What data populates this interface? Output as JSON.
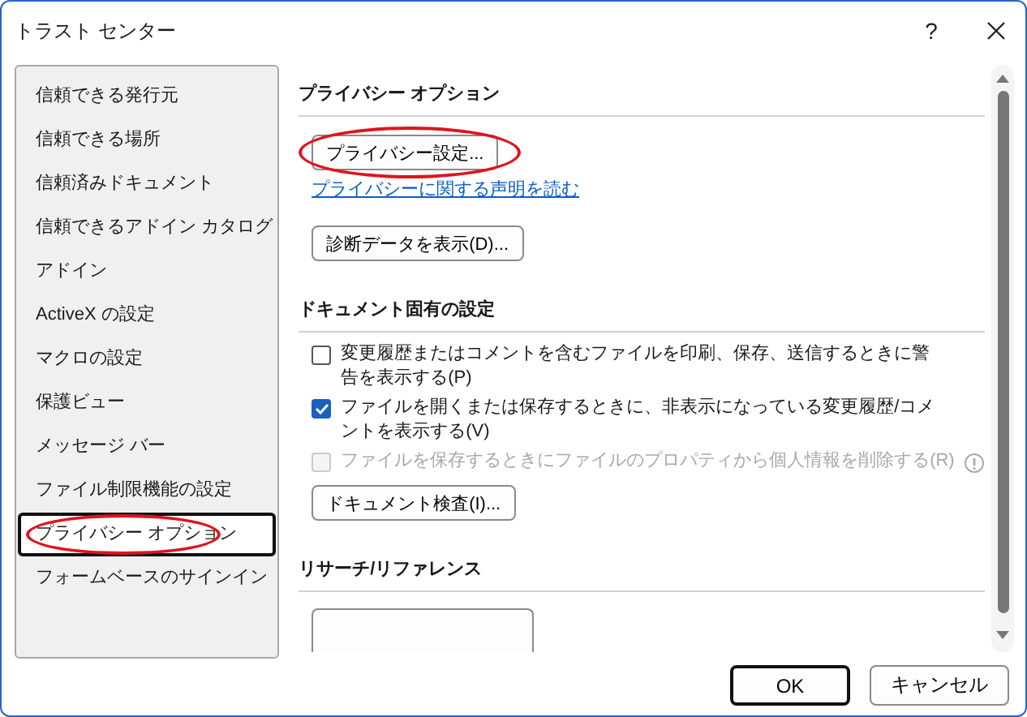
{
  "window": {
    "title": "トラスト センター",
    "help": "?"
  },
  "sidebar": {
    "items": [
      {
        "label": "信頼できる発行元",
        "selected": false,
        "circled": false
      },
      {
        "label": "信頼できる場所",
        "selected": false,
        "circled": false
      },
      {
        "label": "信頼済みドキュメント",
        "selected": false,
        "circled": false
      },
      {
        "label": "信頼できるアドイン カタログ",
        "selected": false,
        "circled": false
      },
      {
        "label": "アドイン",
        "selected": false,
        "circled": false
      },
      {
        "label": "ActiveX の設定",
        "selected": false,
        "circled": false
      },
      {
        "label": "マクロの設定",
        "selected": false,
        "circled": false
      },
      {
        "label": "保護ビュー",
        "selected": false,
        "circled": false
      },
      {
        "label": "メッセージ バー",
        "selected": false,
        "circled": false
      },
      {
        "label": "ファイル制限機能の設定",
        "selected": false,
        "circled": false
      },
      {
        "label": "プライバシー オプション",
        "selected": true,
        "circled": true
      },
      {
        "label": "フォームベースのサインイン",
        "selected": false,
        "circled": false
      }
    ]
  },
  "sections": [
    {
      "heading": "プライバシー オプション",
      "items": [
        {
          "kind": "button",
          "label": "プライバシー設定...",
          "circled": true
        },
        {
          "kind": "link",
          "label": "プライバシーに関する声明を読む"
        },
        {
          "kind": "button",
          "label": "診断データを表示(D)...",
          "circled": false
        }
      ]
    },
    {
      "heading": "ドキュメント固有の設定",
      "items": [
        {
          "kind": "checkbox",
          "label": "変更履歴またはコメントを含むファイルを印刷、保存、送信するときに警告を表示する(P)",
          "checked": false,
          "disabled": false
        },
        {
          "kind": "checkbox",
          "label": "ファイルを開くまたは保存するときに、非表示になっている変更履歴/コメントを表示する(V)",
          "checked": true,
          "disabled": false
        },
        {
          "kind": "checkbox",
          "label": "ファイルを保存するときにファイルのプロパティから個人情報を削除する(R)",
          "checked": false,
          "disabled": true,
          "info": true
        },
        {
          "kind": "button",
          "label": "ドキュメント検査(I)...",
          "circled": false
        }
      ]
    },
    {
      "heading": "リサーチ/リファレンス",
      "items": [
        {
          "kind": "cutbutton"
        }
      ]
    }
  ],
  "buttons": [
    {
      "label": "OK",
      "default": true
    },
    {
      "label": "キャンセル",
      "default": false
    }
  ]
}
